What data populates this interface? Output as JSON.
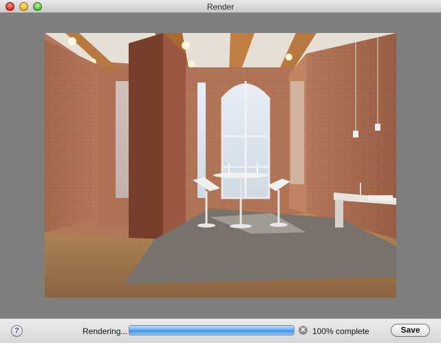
{
  "window": {
    "title": "Render"
  },
  "render": {
    "image": "rendered interior scene of a loft with brick walls, arched windows, bar table and stools"
  },
  "status": {
    "help_label": "?",
    "rendering_label": "Rendering...",
    "progress_fraction": 1.0,
    "percent_label": "100% complete",
    "cancel_icon": "stop-icon",
    "save_label": "Save"
  },
  "colors": {
    "progress_blue": "#3d8fe3",
    "background_gray": "#7f7f7f"
  }
}
